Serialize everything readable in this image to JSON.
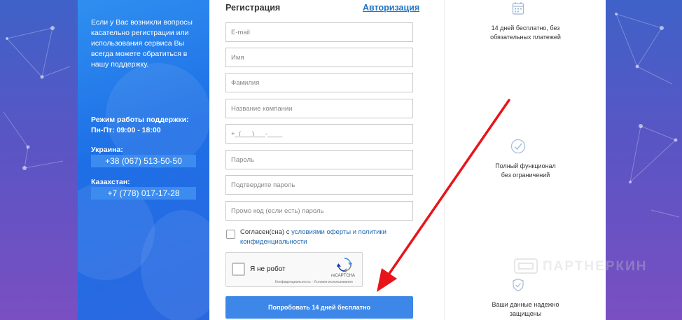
{
  "support": {
    "intro": "Если у Вас возникли вопросы касательно регистрации или использования сервиса Вы всегда можете обратиться в нашу поддержку.",
    "hours_label": "Режим работы поддержки:",
    "hours_value": "Пн-Пт: 09:00 - 18:00",
    "contacts": [
      {
        "country": "Украина:",
        "phone": "+38 (067) 513-50-50"
      },
      {
        "country": "Казахстан:",
        "phone": "+7 (778) 017-17-28"
      }
    ]
  },
  "form": {
    "title": "Регистрация",
    "auth_link": "Авторизация",
    "fields": [
      {
        "name": "email",
        "placeholder": "E-mail"
      },
      {
        "name": "name",
        "placeholder": "Имя"
      },
      {
        "name": "surname",
        "placeholder": "Фамилия"
      },
      {
        "name": "company",
        "placeholder": "Название компании"
      },
      {
        "name": "phone",
        "placeholder": "+_(___)___-____"
      },
      {
        "name": "password",
        "placeholder": "Пароль"
      },
      {
        "name": "password_confirm",
        "placeholder": "Подтвердите пароль"
      },
      {
        "name": "promo",
        "placeholder": "Промо код (если есть) пароль"
      }
    ],
    "agree_prefix": "Согласен(сна) с ",
    "agree_link": "условиями оферты и политики конфиденциальности",
    "captcha": {
      "label": "Я не робот",
      "brand": "reCAPTCHA",
      "links": "Конфиденциальность - Условия использования"
    },
    "submit": "Попробовать 14 дней бесплатно"
  },
  "benefits": [
    {
      "icon": "calendar-icon",
      "text_line1": "14 дней бесплатно, без",
      "text_line2": "обязательных платежей"
    },
    {
      "icon": "checkmark-icon",
      "text_line1": "Полный функционал",
      "text_line2": "без ограничений"
    },
    {
      "icon": "shield-icon",
      "text_line1": "Ваши данные надежно",
      "text_line2": "защищены"
    }
  ],
  "watermark": "ПАРТНЕРКИН",
  "colors": {
    "accent": "#3d87e8",
    "support_panel": "#2b7ded",
    "link": "#1f74c2",
    "arrow": "#e8141a"
  }
}
